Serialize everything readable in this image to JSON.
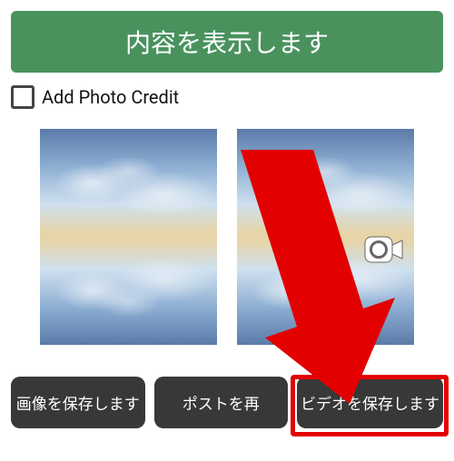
{
  "topButton": {
    "label": "内容を表示します"
  },
  "checkbox": {
    "label": "Add Photo Credit"
  },
  "buttons": {
    "saveImage": "画像を保存します",
    "repost": "ポストを再",
    "saveVideo": "ビデオを保存します"
  }
}
